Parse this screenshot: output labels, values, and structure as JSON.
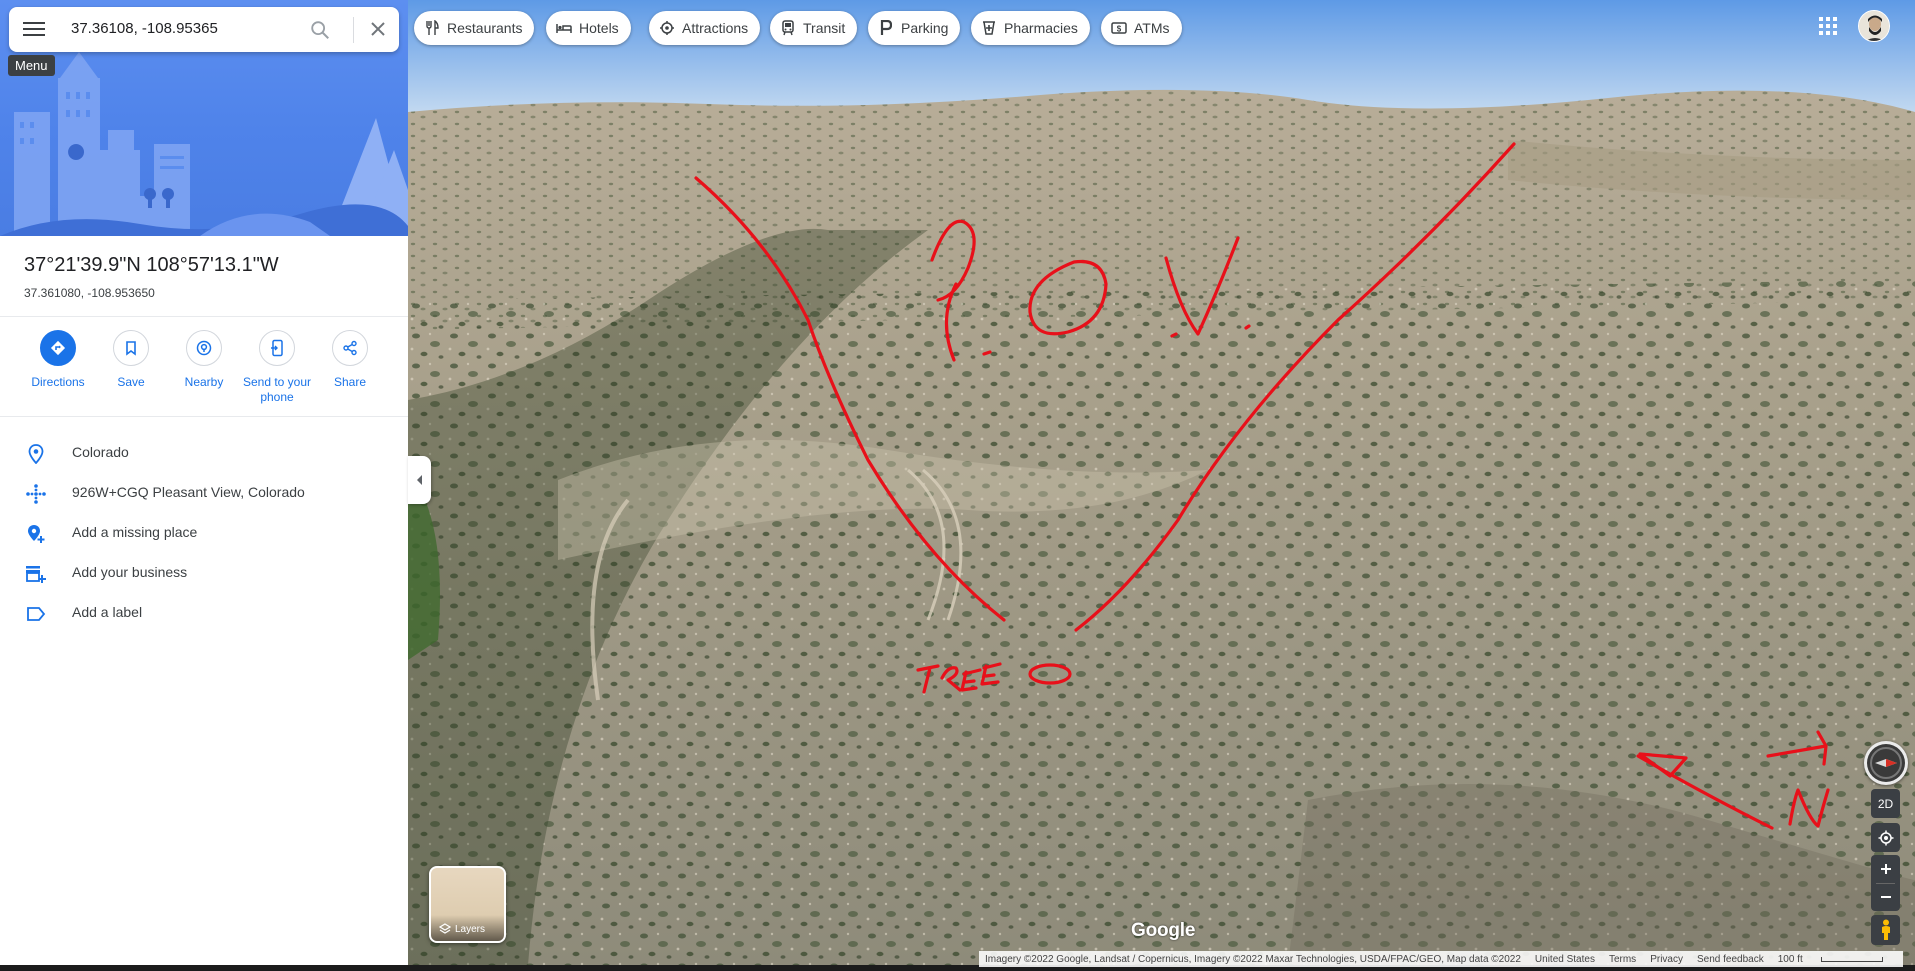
{
  "search": {
    "query": "37.36108, -108.95365"
  },
  "tooltip": {
    "menu": "Menu"
  },
  "place": {
    "title": "37°21'39.9\"N 108°57'13.1\"W",
    "decimal": "37.361080, -108.953650"
  },
  "actions": [
    {
      "label": "Directions",
      "icon": "directions-icon"
    },
    {
      "label": "Save",
      "icon": "bookmark-icon"
    },
    {
      "label": "Nearby",
      "icon": "nearby-icon"
    },
    {
      "label": "Send to your phone",
      "icon": "send-to-phone-icon"
    },
    {
      "label": "Share",
      "icon": "share-icon"
    }
  ],
  "info": [
    {
      "text": "Colorado",
      "icon": "location-pin-icon"
    },
    {
      "text": "926W+CGQ Pleasant View, Colorado",
      "icon": "plus-code-icon"
    },
    {
      "text": "Add a missing place",
      "icon": "add-place-icon"
    },
    {
      "text": "Add your business",
      "icon": "add-business-icon"
    },
    {
      "text": "Add a label",
      "icon": "label-icon"
    }
  ],
  "chips": [
    {
      "label": "Restaurants",
      "icon": "restaurant-icon"
    },
    {
      "label": "Hotels",
      "icon": "hotel-icon"
    },
    {
      "label": "Attractions",
      "icon": "attractions-icon"
    },
    {
      "label": "Transit",
      "icon": "transit-icon"
    },
    {
      "label": "Parking",
      "icon": "parking-icon"
    },
    {
      "label": "Pharmacies",
      "icon": "pharmacy-icon"
    },
    {
      "label": "ATMs",
      "icon": "atm-icon"
    }
  ],
  "layers": {
    "label": "Layers"
  },
  "watermark": "Google",
  "footer": {
    "attribution": "Imagery ©2022 Google, Landsat / Copernicus, Imagery ©2022 Maxar Technologies, USDA/FPAC/GEO, Map data ©2022",
    "country": "United States",
    "terms": "Terms",
    "privacy": "Privacy",
    "feedback": "Send feedback",
    "scale": "100 ft"
  },
  "controls": {
    "view_toggle": "2D"
  },
  "annotations": {
    "pov": "P.O.V.",
    "tree": "TREE",
    "north": "N"
  },
  "colors": {
    "accent": "#1a73e8",
    "annotation": "#e8101a",
    "sidebar_hero": "#5d8ff0"
  }
}
